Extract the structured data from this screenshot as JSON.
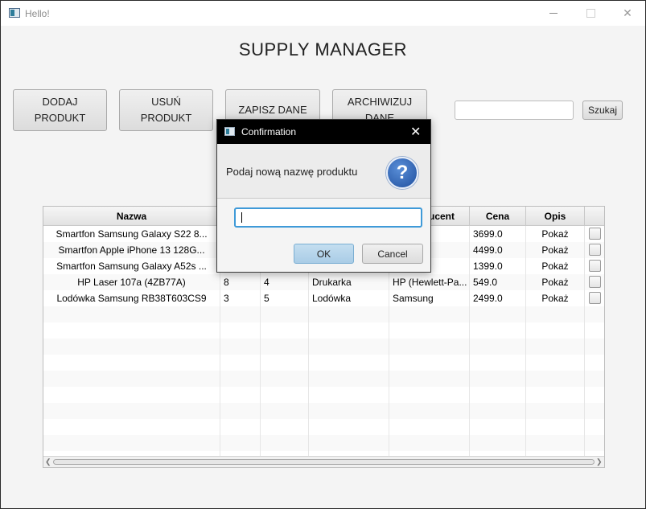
{
  "window": {
    "title": "Hello!"
  },
  "app": {
    "heading": "SUPPLY MANAGER"
  },
  "toolbar": {
    "add_line1": "DODAJ",
    "add_line2": "PRODUKT",
    "remove_line1": "USUŃ",
    "remove_line2": "PRODUKT",
    "save_label": "ZAPISZ DANE",
    "archive_line1": "ARCHIWIZUJ",
    "archive_line2": "DANE",
    "search_value": "",
    "search_button": "Szukaj"
  },
  "table": {
    "headers": [
      "Nazwa",
      "",
      "",
      "",
      "Producent",
      "Cena",
      "Opis",
      ""
    ],
    "rows": [
      {
        "name": "Smartfon Samsung Galaxy S22 8...",
        "c2": "",
        "c3": "",
        "c4": "",
        "producer": "",
        "price": "3699.0",
        "desc": "Pokaż"
      },
      {
        "name": "Smartfon Apple iPhone 13 128G...",
        "c2": "",
        "c3": "",
        "c4": "",
        "producer": "",
        "price": "4499.0",
        "desc": "Pokaż"
      },
      {
        "name": "Smartfon Samsung Galaxy A52s ...",
        "c2": "",
        "c3": "",
        "c4": "",
        "producer": "",
        "price": "1399.0",
        "desc": "Pokaż"
      },
      {
        "name": "HP Laser 107a (4ZB77A)",
        "c2": "8",
        "c3": "4",
        "c4": "Drukarka",
        "producer": "HP (Hewlett-Pa...",
        "price": "549.0",
        "desc": "Pokaż"
      },
      {
        "name": "Lodówka Samsung RB38T603CS9",
        "c2": "3",
        "c3": "5",
        "c4": "Lodówka",
        "producer": "Samsung",
        "price": "2499.0",
        "desc": "Pokaż"
      }
    ]
  },
  "dialog": {
    "title": "Confirmation",
    "message": "Podaj nową nazwę produktu",
    "input_value": "",
    "ok_label": "OK",
    "cancel_label": "Cancel"
  }
}
